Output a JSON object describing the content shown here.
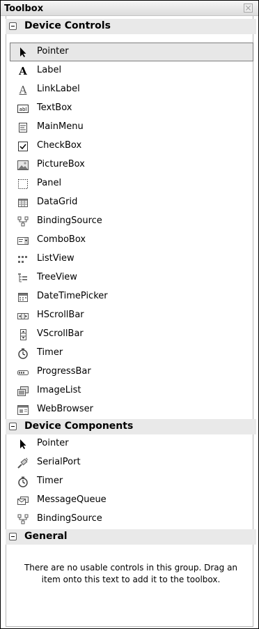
{
  "window": {
    "title": "Toolbox"
  },
  "groups": [
    {
      "label": "Device Controls",
      "items": [
        {
          "label": "Pointer",
          "icon": "pointer-icon"
        },
        {
          "label": "Label",
          "icon": "label-icon"
        },
        {
          "label": "LinkLabel",
          "icon": "linklabel-icon"
        },
        {
          "label": "TextBox",
          "icon": "textbox-icon"
        },
        {
          "label": "MainMenu",
          "icon": "mainmenu-icon"
        },
        {
          "label": "CheckBox",
          "icon": "checkbox-icon"
        },
        {
          "label": "PictureBox",
          "icon": "picturebox-icon"
        },
        {
          "label": "Panel",
          "icon": "panel-icon"
        },
        {
          "label": "DataGrid",
          "icon": "datagrid-icon"
        },
        {
          "label": "BindingSource",
          "icon": "bindingsource-icon"
        },
        {
          "label": "ComboBox",
          "icon": "combobox-icon"
        },
        {
          "label": "ListView",
          "icon": "listview-icon"
        },
        {
          "label": "TreeView",
          "icon": "treeview-icon"
        },
        {
          "label": "DateTimePicker",
          "icon": "datetimepicker-icon"
        },
        {
          "label": "HScrollBar",
          "icon": "hscrollbar-icon"
        },
        {
          "label": "VScrollBar",
          "icon": "vscrollbar-icon"
        },
        {
          "label": "Timer",
          "icon": "timer-icon"
        },
        {
          "label": "ProgressBar",
          "icon": "progressbar-icon"
        },
        {
          "label": "ImageList",
          "icon": "imagelist-icon"
        },
        {
          "label": "WebBrowser",
          "icon": "webbrowser-icon"
        }
      ]
    },
    {
      "label": "Device Components",
      "items": [
        {
          "label": "Pointer",
          "icon": "pointer-icon"
        },
        {
          "label": "SerialPort",
          "icon": "serialport-icon"
        },
        {
          "label": "Timer",
          "icon": "timer-icon"
        },
        {
          "label": "MessageQueue",
          "icon": "messagequeue-icon"
        },
        {
          "label": "BindingSource",
          "icon": "bindingsource-icon"
        }
      ]
    },
    {
      "label": "General",
      "empty_message": "There are no usable controls in this group. Drag an item onto this text to add it to the toolbox."
    }
  ],
  "selected_item": "Pointer"
}
